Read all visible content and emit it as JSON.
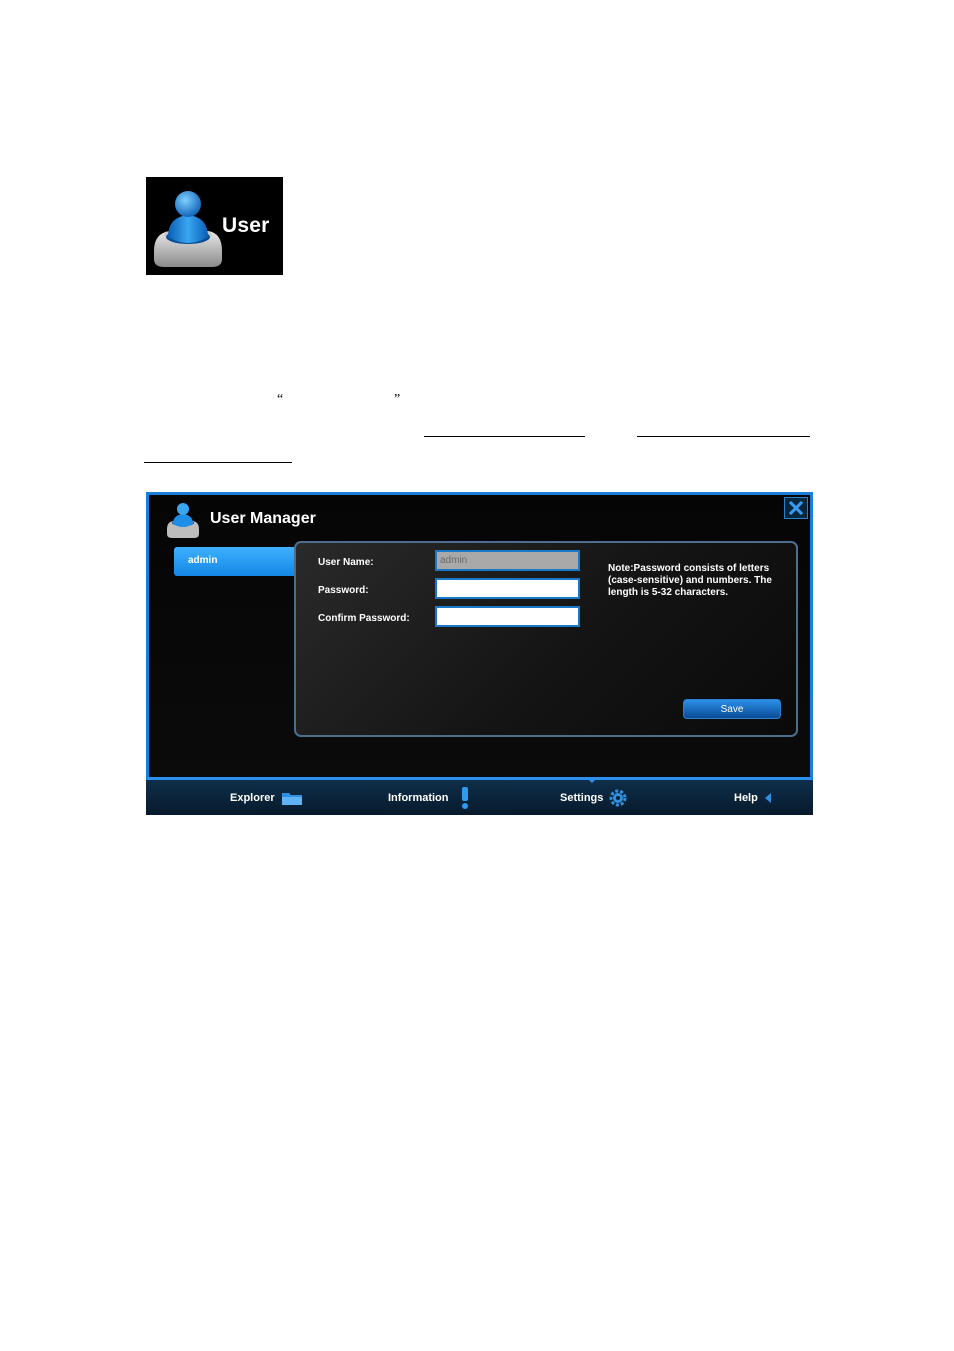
{
  "header_tile": {
    "label": "User"
  },
  "document": {
    "open_quote": "“",
    "close_quote": "”"
  },
  "window": {
    "title": "User Manager",
    "user_list": [
      "admin"
    ],
    "form": {
      "username_label": "User Name:",
      "username_value": "admin",
      "password_label": "Password:",
      "password_value": "",
      "confirm_label": "Confirm Password:",
      "confirm_value": "",
      "note": "Note:Password consists of letters (case-sensitive) and numbers. The length is 5-32 characters.",
      "save_label": "Save"
    },
    "nav": {
      "explorer": "Explorer",
      "information": "Information",
      "settings": "Settings",
      "help": "Help",
      "active": "Settings"
    }
  },
  "colors": {
    "accent": "#1a7fd8",
    "background": "#000000",
    "nav": "#0a2238"
  }
}
